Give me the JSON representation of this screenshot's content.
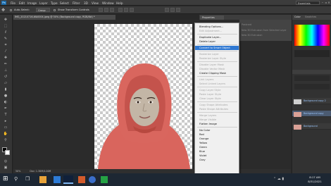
{
  "app": {
    "logo": "Ps"
  },
  "menubar": {
    "items": [
      "File",
      "Edit",
      "Image",
      "Layer",
      "Type",
      "Select",
      "Filter",
      "3D",
      "View",
      "Window",
      "Help"
    ],
    "workspace": "Essentials"
  },
  "options": {
    "auto_select": "Auto-Select:",
    "group": "Group",
    "show_transform": "Show Transform Controls"
  },
  "document": {
    "tab_title": "IMG_20210716-WA0004.jpeg @ 50% (Background copy, RGB/8#) *",
    "zoom": "50%",
    "doc_size": "Doc: 1.30M/4.00M"
  },
  "properties": {
    "tab": "Properties",
    "items": [
      "Postcard",
      "New 3D Extrusion from Selected Layer",
      "New 3D Extrusion"
    ]
  },
  "context_menu": {
    "items": [
      {
        "label": "Blending Options...",
        "disabled": false
      },
      {
        "label": "Edit Adjustment...",
        "disabled": true
      },
      {
        "sep": true
      },
      {
        "label": "Duplicate Layer...",
        "disabled": false
      },
      {
        "label": "Delete Layer",
        "disabled": false
      },
      {
        "sep": true
      },
      {
        "label": "Convert to Smart Object",
        "disabled": false,
        "highlight": true
      },
      {
        "sep": true
      },
      {
        "label": "Rasterize Layer",
        "disabled": true
      },
      {
        "label": "Rasterize Layer Style",
        "disabled": true
      },
      {
        "sep": true
      },
      {
        "label": "Disable Layer Mask",
        "disabled": true
      },
      {
        "label": "Disable Vector Mask",
        "disabled": true
      },
      {
        "label": "Create Clipping Mask",
        "disabled": false
      },
      {
        "sep": true
      },
      {
        "label": "Link Layers",
        "disabled": true
      },
      {
        "label": "Select Linked Layers",
        "disabled": true
      },
      {
        "sep": true
      },
      {
        "label": "Copy Layer Style",
        "disabled": true
      },
      {
        "label": "Paste Layer Style",
        "disabled": true
      },
      {
        "label": "Clear Layer Style",
        "disabled": true
      },
      {
        "sep": true
      },
      {
        "label": "Copy Shape Attributes",
        "disabled": true
      },
      {
        "label": "Paste Shape Attributes",
        "disabled": true
      },
      {
        "sep": true
      },
      {
        "label": "Merge Layers",
        "disabled": true
      },
      {
        "label": "Merge Visible",
        "disabled": true
      },
      {
        "label": "Flatten Image",
        "disabled": false
      },
      {
        "sep": true
      },
      {
        "label": "No Color",
        "disabled": false
      },
      {
        "label": "Red",
        "disabled": false
      },
      {
        "label": "Orange",
        "disabled": false
      },
      {
        "label": "Yellow",
        "disabled": false
      },
      {
        "label": "Green",
        "disabled": false
      },
      {
        "label": "Blue",
        "disabled": false
      },
      {
        "label": "Violet",
        "disabled": false
      },
      {
        "label": "Gray",
        "disabled": false
      }
    ]
  },
  "panels": {
    "tabs": [
      "Color",
      "Swatches"
    ],
    "layers": [
      "Background copy 2",
      "Background copy",
      "Background"
    ]
  },
  "taskbar": {
    "time": "8:17 AM",
    "date": "8/31/2021"
  },
  "colors": {
    "highlight": "#2f78d2",
    "hijab": "#d9655d"
  }
}
